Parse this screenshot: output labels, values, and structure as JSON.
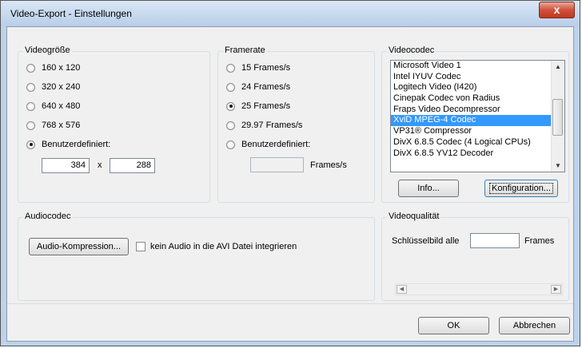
{
  "window": {
    "title": "Video-Export - Einstellungen",
    "close_label": "x"
  },
  "videogroesse": {
    "title": "Videogröße",
    "options": [
      "160 x 120",
      "320 x 240",
      "640 x 480",
      "768 x 576",
      "Benutzerdefiniert:"
    ],
    "selected_index": 4,
    "width_value": "384",
    "times_label": "x",
    "height_value": "288"
  },
  "framerate": {
    "title": "Framerate",
    "options": [
      "15 Frames/s",
      "24 Frames/s",
      "25 Frames/s",
      "29.97 Frames/s",
      "Benutzerdefiniert:"
    ],
    "selected_index": 2,
    "custom_value": "",
    "unit_label": "Frames/s"
  },
  "videocodec": {
    "title": "Videocodec",
    "items": [
      "Microsoft Video 1",
      "Intel IYUV Codec",
      "Logitech Video (I420)",
      "Cinepak Codec von Radius",
      "Fraps Video Decompressor",
      "XviD MPEG-4 Codec",
      "VP31® Compressor",
      "DivX 6.8.5 Codec (4 Logical CPUs)",
      "DivX 6.8.5 YV12 Decoder"
    ],
    "selected_index": 5,
    "info_label": "Info...",
    "config_label": "Konfiguration..."
  },
  "audiocodec": {
    "title": "Audiocodec",
    "compress_label": "Audio-Kompression...",
    "no_audio_label": "kein Audio in die AVI Datei integrieren",
    "no_audio_checked": false
  },
  "videoqualitaet": {
    "title": "Videoqualität",
    "keyframe_label": "Schlüsselbild alle",
    "keyframe_value": "",
    "frames_label": "Frames"
  },
  "footer": {
    "ok_label": "OK",
    "cancel_label": "Abbrechen"
  }
}
